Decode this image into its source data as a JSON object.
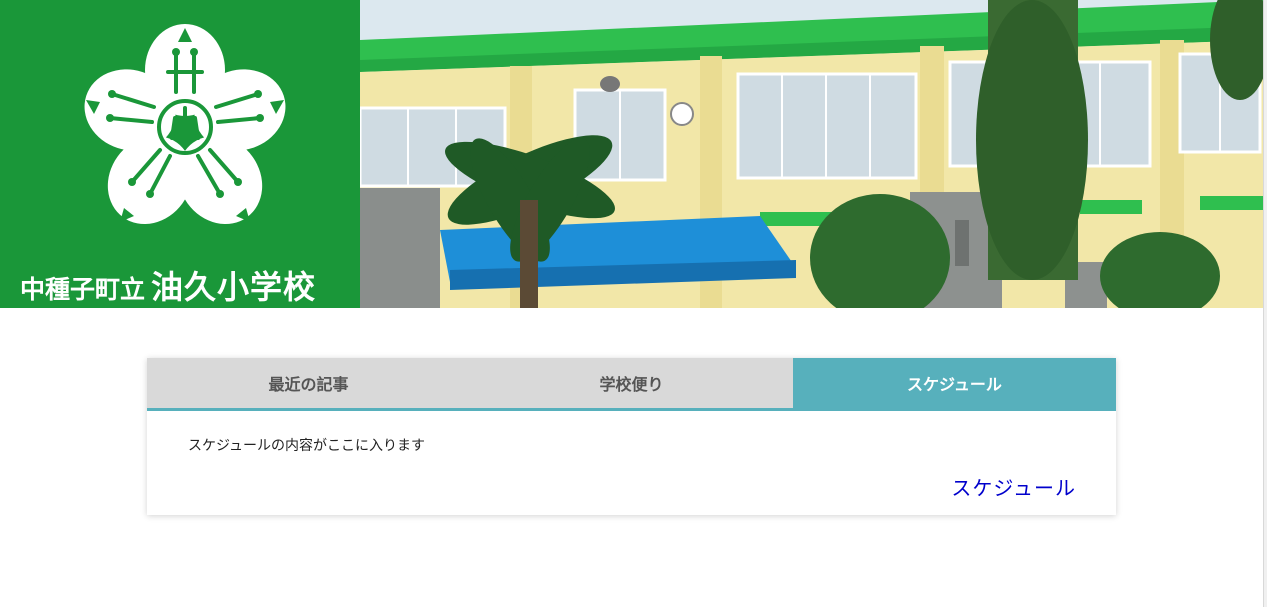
{
  "header": {
    "logo_town": "中種子町立",
    "logo_school": "油久小学校",
    "logo_emblem_icon": "sakura-emblem-icon",
    "brand_color": "#1a9739",
    "photo_icon": "school-building-photo"
  },
  "tabs": {
    "items": [
      {
        "label": "最近の記事"
      },
      {
        "label": "学校便り"
      },
      {
        "label": "スケジュール"
      }
    ],
    "active_index": 2,
    "accent_color": "#57b0bc",
    "inactive_color": "#d9d9d9"
  },
  "content": {
    "text": "スケジュールの内容がここに入ります",
    "link_label": "スケジュール"
  }
}
